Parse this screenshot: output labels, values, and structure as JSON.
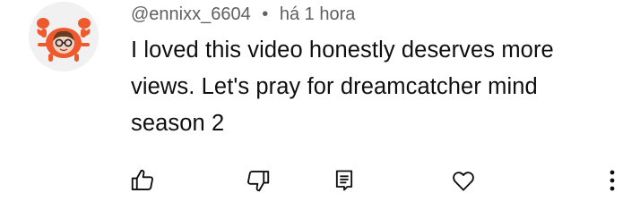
{
  "comment": {
    "author": "@ennixx_6604",
    "separator": "•",
    "timestamp": "há 1 hora",
    "text": "I loved this video honestly deserves more views. Let's pray for dreamcatcher mind season 2",
    "avatar_icon": "crab-avatar-icon"
  },
  "actions": {
    "like_icon": "thumbs-up-icon",
    "dislike_icon": "thumbs-down-icon",
    "reply_icon": "reply-icon",
    "heart_icon": "heart-icon",
    "more_icon": "more-vertical-icon"
  },
  "colors": {
    "author_meta": "#606060",
    "text": "#0f0f0f",
    "avatar_bg": "#f1f1f1",
    "crab": "#ee5a2e"
  }
}
